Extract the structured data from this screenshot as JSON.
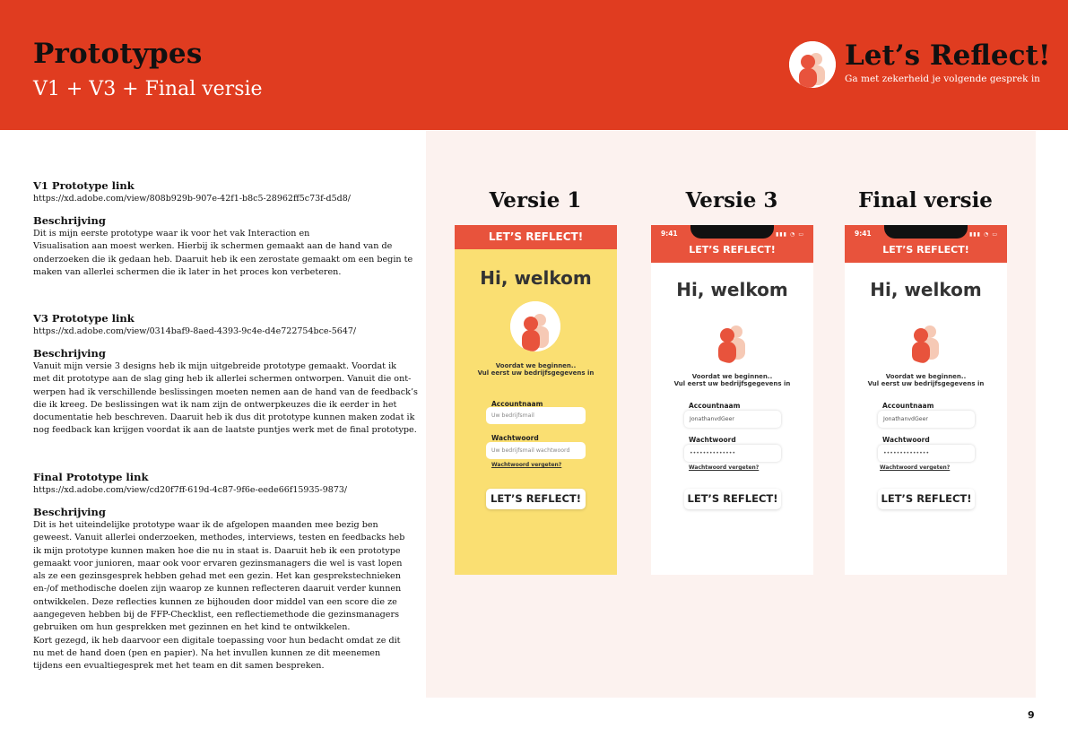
{
  "header": {
    "title": "Prototypes",
    "subtitle": "V1 + V3 + Final versie",
    "brand_name": "Let’s Reflect!",
    "brand_tagline": "Ga met zekerheid je volgende gesprek in",
    "brand_logo": "person-avatar-icon",
    "colors": {
      "header_bg": "#e03c20",
      "panel_bg": "#fcf2ef",
      "phone_bar": "#e8533c",
      "v1_bg": "#fadf72"
    }
  },
  "left": {
    "v1": {
      "link_label": "V1 Prototype link",
      "url": "https://xd.adobe.com/view/808b929b-907e-42f1-b8c5-28962ff5c73f-d5d8/",
      "desc_label": "Beschrijving",
      "desc_lines": [
        "Dit is mijn eerste prototype waar ik voor het vak Interaction en",
        "Visualisation aan moest werken. Hierbij ik schermen gemaakt aan de hand van de",
        "onderzoeken die ik gedaan heb. Daaruit heb ik een zerostate gemaakt om een begin te",
        "maken van allerlei schermen die ik later in het proces kon verbeteren."
      ]
    },
    "v3": {
      "link_label": "V3 Prototype link",
      "url": "https://xd.adobe.com/view/0314baf9-8aed-4393-9c4e-d4e722754bce-5647/",
      "desc_label": "Beschrijving",
      "desc_lines": [
        "Vanuit mijn versie 3 designs heb ik mijn uitgebreide prototype gemaakt. Voordat ik",
        "met dit prototype aan de slag ging heb ik allerlei schermen ontworpen. Vanuit die ont-",
        "werpen had ik verschillende beslissingen moeten nemen aan de hand van de feedback’s",
        "die ik kreeg. De beslissingen wat ik nam zijn de ontwerpkeuzes die ik eerder in het",
        "documentatie heb beschreven. Daaruit heb ik dus dit prototype kunnen maken zodat ik",
        "nog feedback kan krijgen voordat ik aan de laatste puntjes werk met de final prototype."
      ]
    },
    "final": {
      "link_label": "Final Prototype link",
      "url": "https://xd.adobe.com/view/cd20f7ff-619d-4c87-9f6e-eede66f15935-9873/",
      "desc_label": "Beschrijving",
      "desc_lines": [
        "Dit is het uiteindelijke prototype waar ik de afgelopen maanden mee bezig ben",
        "geweest. Vanuit allerlei onderzoeken, methodes, interviews, testen en feedbacks heb",
        "ik mijn prototype kunnen maken hoe die nu in staat is. Daaruit heb ik een prototype",
        "gemaakt voor junioren, maar ook voor ervaren gezinsmanagers die wel is vast lopen",
        "als ze een gezinsgesprek hebben gehad met een gezin. Het kan gesprekstechnieken",
        "en-/of methodische doelen zijn waarop ze kunnen reflecteren daaruit verder kunnen",
        "ontwikkelen. Deze reflecties kunnen ze bijhouden door middel van een score die ze",
        "aangegeven hebben bij de FFP-Checklist, een reflectiemethode die gezinsmanagers",
        "gebruiken om hun gesprekken met gezinnen en het kind te ontwikkelen.",
        "Kort gezegd, ik heb daarvoor een digitale toepassing voor hun bedacht omdat ze dit",
        "nu met de hand doen (pen en papier). Na het invullen kunnen ze dit meenemen",
        "tijdens een evualtiegesprek met het team en dit samen bespreken."
      ]
    }
  },
  "phones": {
    "v1": {
      "col_title": "Versie 1",
      "bar": "LET’S REFLECT!",
      "greeting": "Hi, welkom",
      "intro_1": "Voordat we beginnen..",
      "intro_2": "Vul eerst uw bedrijfsgegevens in",
      "account_label": "Accountnaam",
      "account_placeholder": "Uw bedrijfsmail",
      "password_label": "Wachtwoord",
      "password_placeholder": "Uw bedrijfsmail wachtwoord",
      "forgot": "Wachtwoord vergeten?",
      "button": "LET’S REFLECT!"
    },
    "v3": {
      "col_title": "Versie 3",
      "time": "9:41",
      "bar": "LET’S REFLECT!",
      "greeting": "Hi, welkom",
      "intro_1": "Voordat we beginnen..",
      "intro_2": "Vul eerst uw bedrijfsgegevens in",
      "account_label": "Accountnaam",
      "account_value": "JonathanvdGeer",
      "password_label": "Wachtwoord",
      "password_value": "••••••••••••••",
      "forgot": "Wachtwoord vergeten?",
      "button": "LET’S REFLECT!"
    },
    "final": {
      "col_title": "Final versie",
      "time": "9:41",
      "bar": "LET’S REFLECT!",
      "greeting": "Hi, welkom",
      "intro_1": "Voordat we beginnen..",
      "intro_2": "Vul eerst uw bedrijfsgegevens in",
      "account_label": "Accountnaam",
      "account_value": "JonathanvdGeer",
      "password_label": "Wachtwoord",
      "password_value": "••••••••••••••",
      "forgot": "Wachtwoord vergeten?",
      "button": "LET’S REFLECT!"
    }
  },
  "page_number": "9"
}
